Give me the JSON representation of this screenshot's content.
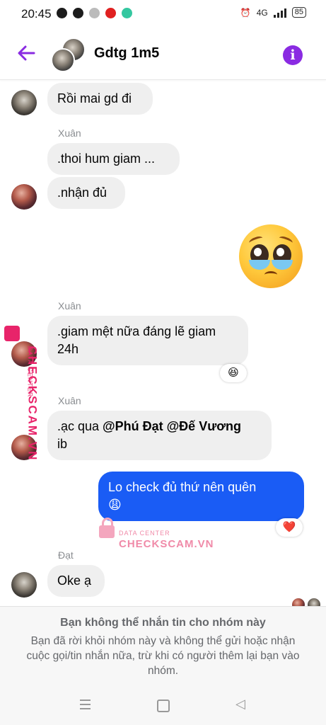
{
  "status": {
    "time": "20:45",
    "battery": "85",
    "network": "4G"
  },
  "header": {
    "title": "Gdtg 1m5",
    "back_icon": "arrow-left-icon",
    "info_icon": "info-icon",
    "accent_color": "#8a2be2"
  },
  "messages": [
    {
      "sender": "",
      "text": "Rồi mai gd đi",
      "mine": false
    },
    {
      "sender": "Xuân",
      "text": ".thoi hum giam ...",
      "mine": false
    },
    {
      "sender": "",
      "text": ".nhận đủ",
      "mine": false
    },
    {
      "sender": "",
      "text": "pleading-face-emoji",
      "mine": true
    },
    {
      "sender": "Xuân",
      "text_line1": ".giam mệt nữa đáng lẽ giam",
      "text_line2": "24h",
      "reaction": "😆",
      "mine": false
    },
    {
      "sender": "Xuân",
      "text_prefix": ".ạc qua ",
      "mention1": "@Phú Đạt",
      "mention2": "@Đế Vương",
      "text_line2": "ib",
      "mine": false
    },
    {
      "sender": "",
      "text_line1": "Lo check đủ thứ nên quên",
      "text_line2": "😩",
      "reaction": "❤️",
      "mine": true
    },
    {
      "sender": "Đạt",
      "text": "Oke ạ",
      "mine": false
    }
  ],
  "watermark": {
    "small": "DATA CENTER",
    "big": "CHECKSCAM.VN"
  },
  "footer": {
    "title": "Bạn không thể nhắn tin cho nhóm này",
    "text": "Bạn đã rời khỏi nhóm này và không thể gửi hoặc nhận cuộc gọi/tin nhắn nữa, trừ khi có người thêm lại bạn vào nhóm."
  },
  "colors": {
    "my_bubble": "#1a5cf5",
    "their_bubble": "#efefef",
    "watermark": "#e8246a"
  }
}
